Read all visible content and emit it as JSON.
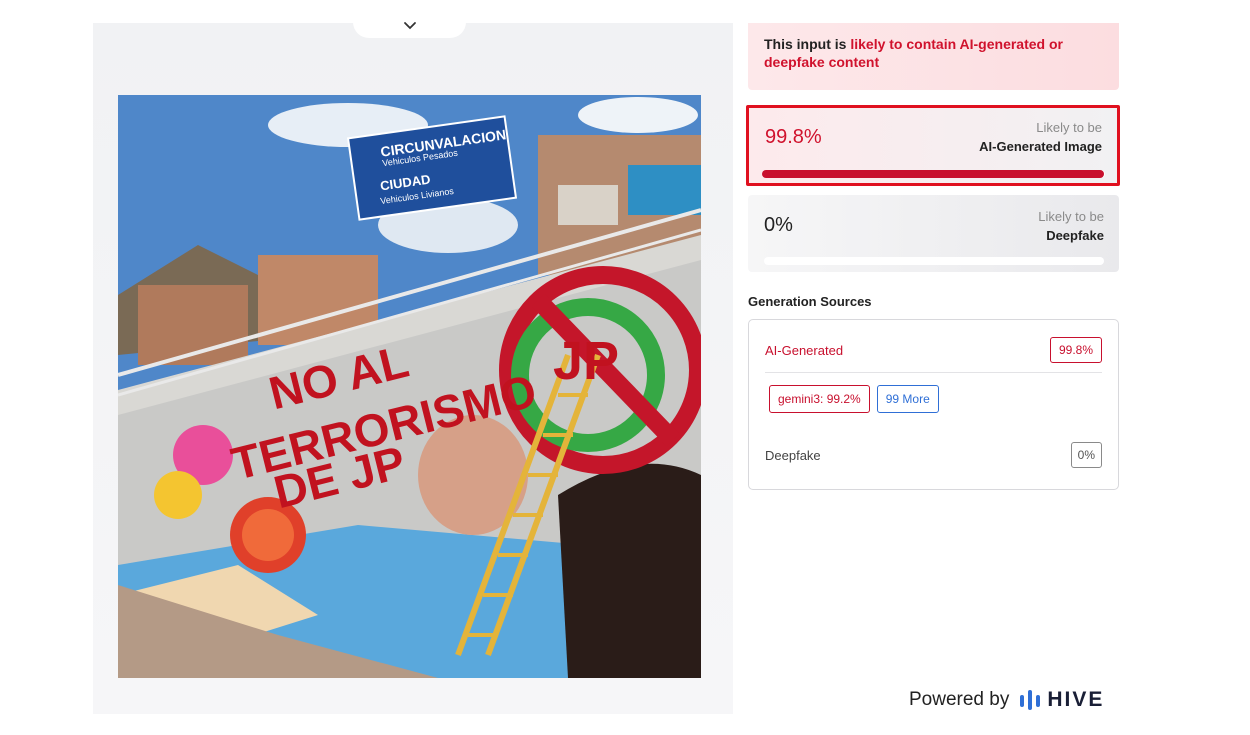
{
  "photo": {
    "sign_line1": "CIRCUNVALACION",
    "sign_line2": "Vehiculos  Pesados",
    "sign_line3": "CIUDAD",
    "sign_line4": "Vehiculos  Livianos",
    "graffiti_line1": "NO AL",
    "graffiti_line2": "TERRORISMO",
    "graffiti_line3": "DE JP",
    "symbol_text": "JP"
  },
  "verdict": {
    "prefix": "This input is ",
    "highlight": "likely to contain AI-generated or deepfake content"
  },
  "ai_score": {
    "value": "99.8%",
    "fraction": 0.998,
    "label_top": "Likely to be",
    "label_bottom": "AI-Generated Image"
  },
  "deepfake_score": {
    "value": "0%",
    "fraction": 0.0,
    "label_top": "Likely to be",
    "label_bottom": "Deepfake"
  },
  "sources": {
    "title": "Generation Sources",
    "ai_label": "AI-Generated",
    "ai_badge": "99.8%",
    "chips": [
      "gemini3: 99.2%",
      "99 More"
    ],
    "deepfake_label": "Deepfake",
    "deepfake_badge": "0%"
  },
  "footer": {
    "powered_by": "Powered by",
    "brand": "HIVE"
  },
  "colors": {
    "accent_red": "#c8102e",
    "link_blue": "#2f6fd6"
  },
  "icons": {
    "collapse": "chevron-down-icon",
    "brand_logo": "hive-logo-icon"
  }
}
